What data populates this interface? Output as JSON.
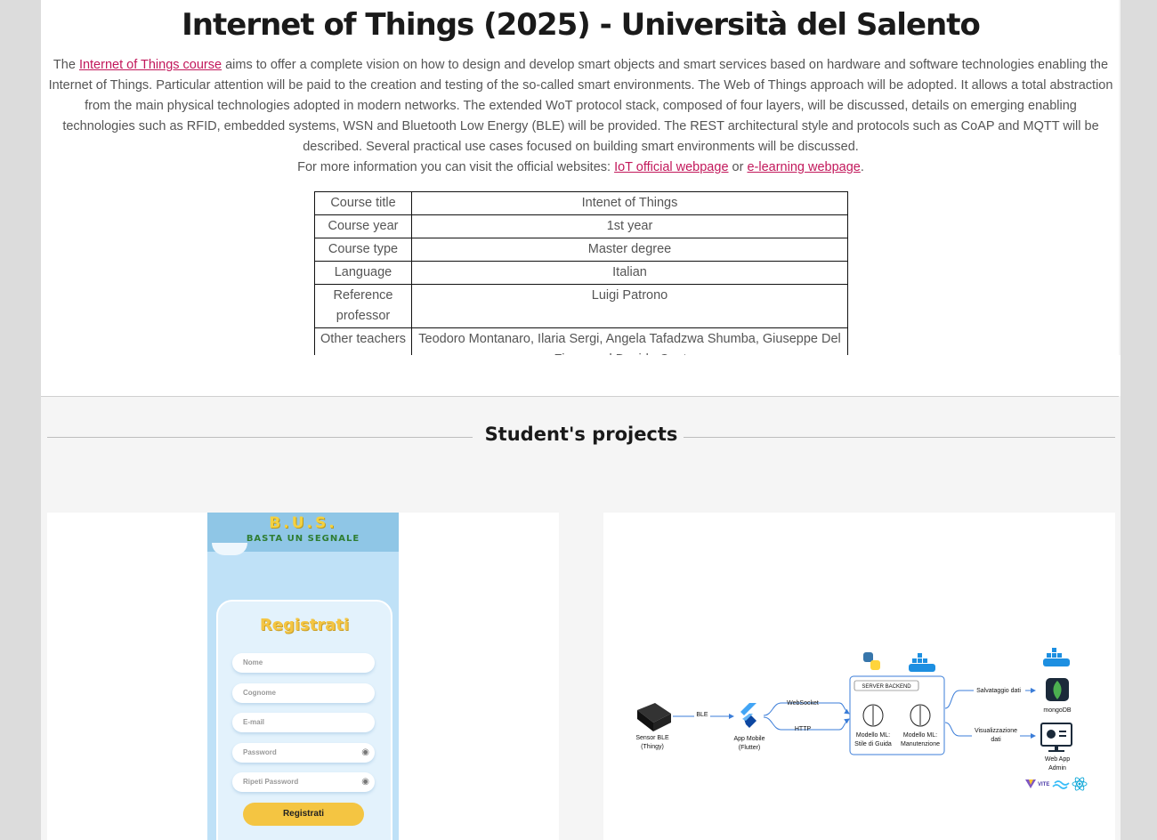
{
  "course": {
    "title": "Internet of Things (2025) - Università del Salento",
    "desc_prefix": "The ",
    "desc_link": "Internet of Things course",
    "desc_body": " aims to offer a complete vision on how to design and develop smart objects and smart services based on hardware and software technologies enabling the Internet of Things. Particular attention will be paid to the creation and testing of the so-called smart environments. The Web of Things approach will be adopted. It allows a total abstraction from the main physical technologies adopted in modern networks. The extended WoT protocol stack, composed of four layers, will be discussed, details on emerging enabling technologies such as RFID, embedded systems, WSN and Bluetooth Low Energy (BLE) will be provided. The REST architectural style and protocols such as CoAP and MQTT will be described. Several practical use cases focused on building smart environments will be discussed.",
    "more_prefix": "For more information you can visit the official websites: ",
    "link_iot": "IoT official webpage",
    "more_or": " or ",
    "link_elearning": "e-learning webpage",
    "more_suffix": ".",
    "info_rows": [
      {
        "key": "Course title",
        "value": "Intenet of Things"
      },
      {
        "key": "Course year",
        "value": "1st year"
      },
      {
        "key": "Course type",
        "value": "Master degree"
      },
      {
        "key": "Language",
        "value": "Italian"
      },
      {
        "key": "Reference professor",
        "value": "Luigi Patrono"
      },
      {
        "key": "Other teachers",
        "value": "Teodoro Montanaro, Ilaria Sergi, Angela Tafadzwa Shumba, Giuseppe Del Fiore, and Davide Cantoro"
      }
    ]
  },
  "projects": {
    "heading": "Student's projects",
    "bus_app": {
      "logo": "B.U.S.",
      "tagline": "BASTA UN SEGNALE",
      "form_title": "Registrati",
      "fields": [
        "Nome",
        "Cognome",
        "E-mail",
        "Password",
        "Ripeti Password"
      ],
      "submit_label": "Registrati"
    },
    "architecture": {
      "sensor": "Sensor BLE\n(Thingy)",
      "sensor_l1": "Sensor BLE",
      "sensor_l2": "(Thingy)",
      "ble": "BLE",
      "app_l1": "App Mobile",
      "app_l2": "(Flutter)",
      "websocket": "WebSocket",
      "http": "HTTP",
      "server": "SERVER BACKEND",
      "model1_l1": "Modello ML:",
      "model1_l2": "Stile di Guida",
      "model2_l1": "Modello ML:",
      "model2_l2": "Manutenzione",
      "save": "Salvataggio dati",
      "viz_l1": "Visualizzazione",
      "viz_l2": "dati",
      "db": "mongoDB",
      "web_l1": "Web App",
      "web_l2": "Admin",
      "vite": "VITE"
    }
  }
}
